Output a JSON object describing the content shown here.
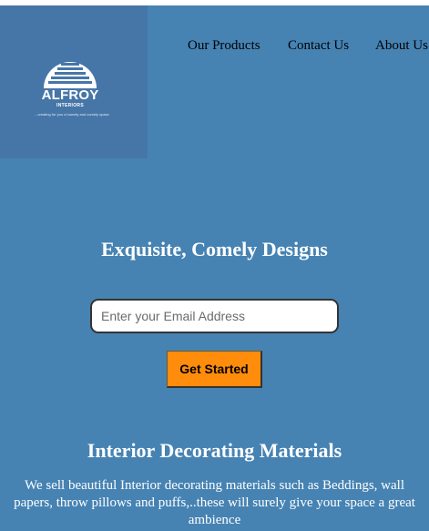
{
  "logo": {
    "name": "ALFROY",
    "sub": "INTERIORS",
    "tagline": "...creating for you a homely and comely space"
  },
  "nav": {
    "items": [
      {
        "label": "Our Products"
      },
      {
        "label": "Contact Us"
      },
      {
        "label": "About Us"
      }
    ]
  },
  "hero": {
    "title": "Exquisite, Comely Designs",
    "email_placeholder": "Enter your Email Address",
    "cta_label": "Get Started"
  },
  "section": {
    "title": "Interior Decorating Materials",
    "text": "We sell beautiful Interior decorating materials such as Beddings, wall papers, throw pillows and puffs,..these will surely give your space a great ambience"
  },
  "colors": {
    "page_background": "#4683b3",
    "logo_background": "#4676a8",
    "button": "#ff8c0a",
    "heading_text": "#ffffff"
  }
}
